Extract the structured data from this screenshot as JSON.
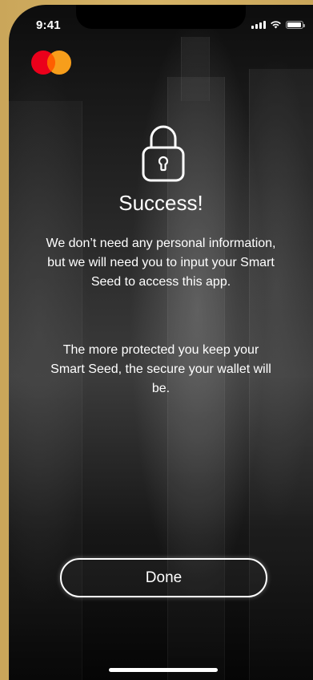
{
  "status_bar": {
    "time": "9:41",
    "icons": [
      "cellular-signal-icon",
      "wifi-icon",
      "battery-icon"
    ]
  },
  "brand": {
    "logo_icon": "mastercard-logo-icon",
    "colors": {
      "left_circle": "#eb001b",
      "right_circle": "#f79e1b",
      "overlap": "#ff5f00"
    }
  },
  "main": {
    "icon": "padlock-icon",
    "title": "Success!",
    "paragraph_1": "We don’t need any personal information, but we will need you to input your Smart Seed to access this app.",
    "paragraph_2": "The more protected you keep your Smart Seed, the secure your wallet will be."
  },
  "actions": {
    "done_label": "Done"
  },
  "colors": {
    "frame": "#caa65a",
    "background": "#1a1a1a",
    "text": "#ffffff"
  }
}
